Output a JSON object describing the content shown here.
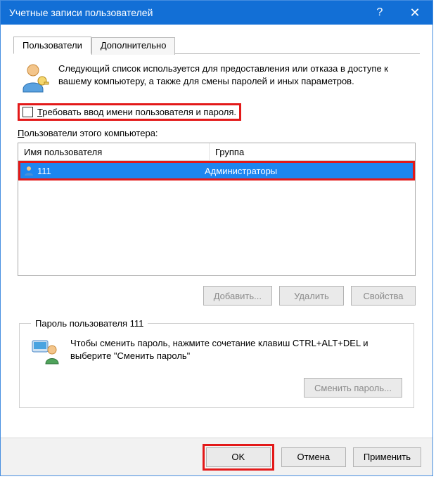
{
  "window": {
    "title": "Учетные записи пользователей"
  },
  "tabs": {
    "users": "Пользователи",
    "advanced": "Дополнительно"
  },
  "intro": "Следующий список используется для предоставления или отказа в доступе к вашему компьютеру, а также для смены паролей и иных параметров.",
  "require_login": {
    "label": "Требовать ввод имени пользователя и пароля.",
    "checked": false
  },
  "users_section_label": "Пользователи этого компьютера:",
  "columns": {
    "name": "Имя пользователя",
    "group": "Группа"
  },
  "rows": [
    {
      "name": "111",
      "group": "Администраторы",
      "selected": true
    }
  ],
  "buttons": {
    "add": "Добавить...",
    "remove": "Удалить",
    "props": "Свойства"
  },
  "pw_group": {
    "legend": "Пароль пользователя 111",
    "text": "Чтобы сменить пароль, нажмите сочетание клавиш CTRL+ALT+DEL и выберите \"Сменить пароль\"",
    "change_btn": "Сменить пароль..."
  },
  "footer": {
    "ok": "OK",
    "cancel": "Отмена",
    "apply": "Применить"
  }
}
